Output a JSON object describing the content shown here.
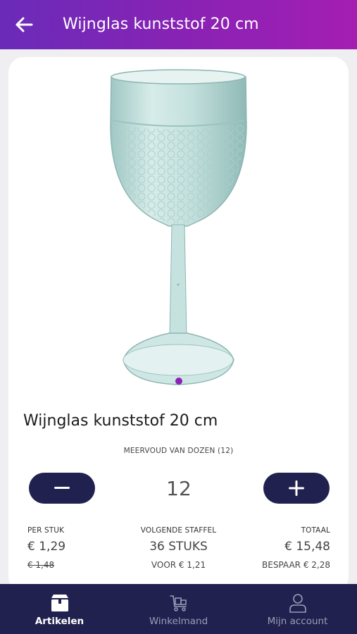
{
  "header": {
    "title": "Wijnglas kunststof 20 cm",
    "back_icon": "arrow-left-icon"
  },
  "product": {
    "title": "Wijnglas kunststof 20 cm",
    "image": "wine-glass-image",
    "carousel_position": 1
  },
  "quantity": {
    "multiple_label": "MEERVOUD VAN DOZEN (12)",
    "value": "12",
    "decrease_icon": "minus-icon",
    "increase_icon": "plus-icon"
  },
  "pricing": {
    "per_piece_label": "PER STUK",
    "per_piece_price": "€ 1,29",
    "per_piece_old_price": "€ 1,48",
    "next_tier_label": "VOLGENDE STAFFEL",
    "next_tier_qty": "36 STUKS",
    "next_tier_price": "VOOR € 1,21",
    "total_label": "TOTAAL",
    "total_price": "€ 15,48",
    "savings": "BESPAAR € 2,28"
  },
  "nav": {
    "items": [
      {
        "label": "Artikelen",
        "icon": "box-icon",
        "active": true
      },
      {
        "label": "Winkelmand",
        "icon": "cart-icon",
        "active": false
      },
      {
        "label": "Mijn account",
        "icon": "user-icon",
        "active": false
      }
    ]
  },
  "colors": {
    "header_gradient_start": "#6a2bb8",
    "header_gradient_end": "#a51eb3",
    "navy": "#21214f",
    "accent_dot": "#8a22b4"
  }
}
